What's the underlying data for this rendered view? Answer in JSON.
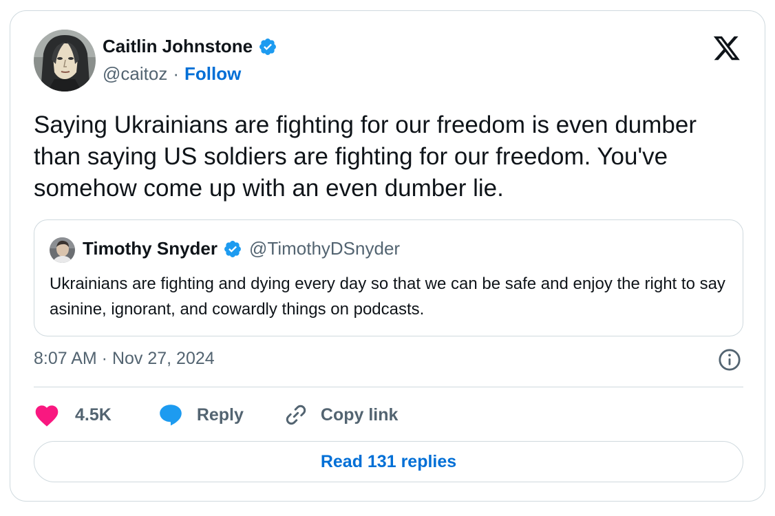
{
  "author": {
    "name": "Caitlin Johnstone",
    "handle": "@caitoz",
    "separator": "·",
    "follow_label": "Follow"
  },
  "tweet": {
    "text": "Saying Ukrainians are fighting for our freedom is even dumber than saying US soldiers are fighting for our freedom. You've somehow come up with an even dumber lie.",
    "timestamp": "8:07 AM · Nov 27, 2024"
  },
  "quoted": {
    "name": "Timothy Snyder",
    "handle": "@TimothyDSnyder",
    "text": "Ukrainians are fighting and dying every day so that we can be safe and enjoy the right to say asinine, ignorant, and cowardly things on podcasts."
  },
  "actions": {
    "like_count": "4.5K",
    "reply_label": "Reply",
    "copy_label": "Copy link"
  },
  "read_replies_label": "Read 131 replies",
  "icons": {
    "brand": "x-logo-icon",
    "verified": "verified-badge-icon",
    "info": "info-icon",
    "like": "heart-icon",
    "reply": "speech-bubble-icon",
    "copy": "link-icon"
  },
  "colors": {
    "accent": "#006fd6",
    "verified": "#1d9bf0",
    "like": "#f91880",
    "secondary_text": "#536471",
    "border": "#cfd9de"
  }
}
